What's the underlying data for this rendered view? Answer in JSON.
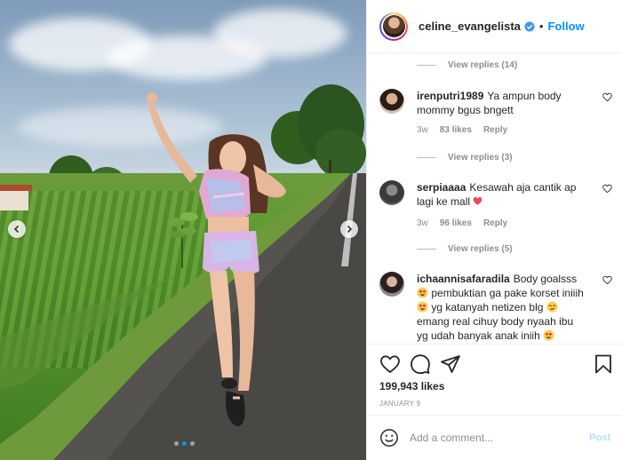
{
  "post": {
    "username": "celine_evangelista",
    "separator": "•",
    "follow_label": "Follow",
    "carousel": {
      "slide_count": 3,
      "active_slide": 1
    }
  },
  "comments": {
    "reply_links": [
      {
        "label": "View replies (14)"
      },
      {
        "label": "View replies (3)"
      },
      {
        "label": "View replies (5)"
      }
    ],
    "items": [
      {
        "user": "irenputri1989",
        "text": "Ya ampun body mommy bgus bngett",
        "time": "3w",
        "likes": "83 likes",
        "reply_label": "Reply"
      },
      {
        "user": "serpiaaaa",
        "text": "Kesawah aja cantik ap lagi ke mall",
        "time": "3w",
        "likes": "96 likes",
        "reply_label": "Reply"
      },
      {
        "user": "ichaannisafaradila",
        "text_1": "Body goalsss",
        "text_2": "pembuktian ga pake korset iniiih",
        "text_3": "yg katanyah netizen blg",
        "text_4": "emang real cihuy body nyaah ibu yg udah banyak anak iniih"
      }
    ]
  },
  "actions": {
    "likes": "199,943 likes",
    "date": "JANUARY 9"
  },
  "composer": {
    "placeholder": "Add a comment...",
    "post_label": "Post"
  },
  "colors": {
    "accent": "#0095f6",
    "muted": "#8e8e8e",
    "post_disabled": "#b2dffc",
    "heart_red": "#ed4956"
  }
}
